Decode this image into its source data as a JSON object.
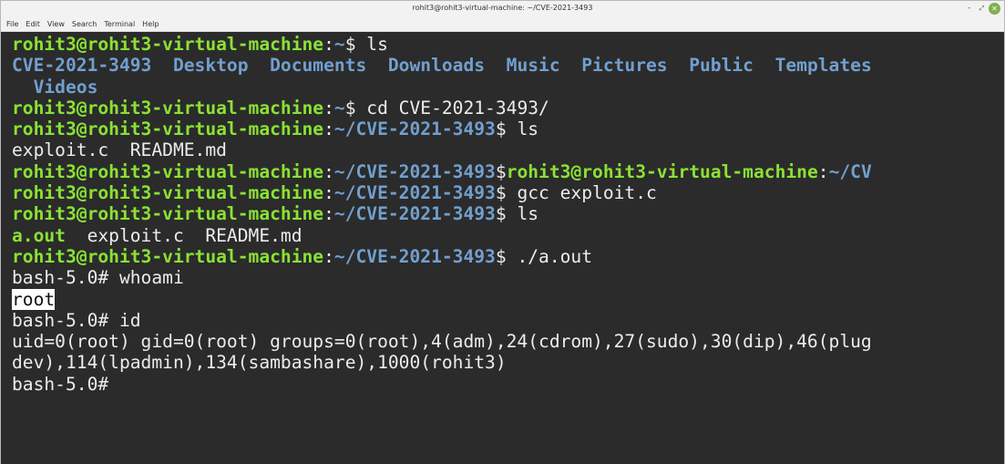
{
  "window": {
    "title": "rohit3@rohit3-virtual-machine: ~/CVE-2021-3493",
    "menu": [
      "File",
      "Edit",
      "View",
      "Search",
      "Terminal",
      "Help"
    ],
    "controls": {
      "minimize": "-",
      "maximize": "⤢",
      "close": "✕"
    }
  },
  "terminal": {
    "colors": {
      "background": "#2b2b2b",
      "prompt": "#8ae234",
      "path": "#729fcf",
      "text": "#ececec"
    },
    "lines": [
      [
        {
          "text": "rohit3@rohit3-virtual-machine",
          "style": "prompt"
        },
        {
          "text": ":",
          "style": "plain"
        },
        {
          "text": "~",
          "style": "path"
        },
        {
          "text": "$ ls",
          "style": "plain"
        }
      ],
      [
        {
          "text": "CVE-2021-3493",
          "style": "dir"
        },
        {
          "text": "  ",
          "style": "plain"
        },
        {
          "text": "Desktop",
          "style": "dir"
        },
        {
          "text": "  ",
          "style": "plain"
        },
        {
          "text": "Documents",
          "style": "dir"
        },
        {
          "text": "  ",
          "style": "plain"
        },
        {
          "text": "Downloads",
          "style": "dir"
        },
        {
          "text": "  ",
          "style": "plain"
        },
        {
          "text": "Music",
          "style": "dir"
        },
        {
          "text": "  ",
          "style": "plain"
        },
        {
          "text": "Pictures",
          "style": "dir"
        },
        {
          "text": "  ",
          "style": "plain"
        },
        {
          "text": "Public",
          "style": "dir"
        },
        {
          "text": "  ",
          "style": "plain"
        },
        {
          "text": "Templates",
          "style": "dir"
        }
      ],
      [
        {
          "text": "  ",
          "style": "plain"
        },
        {
          "text": "Videos",
          "style": "dir"
        }
      ],
      [
        {
          "text": "rohit3@rohit3-virtual-machine",
          "style": "prompt"
        },
        {
          "text": ":",
          "style": "plain"
        },
        {
          "text": "~",
          "style": "path"
        },
        {
          "text": "$ cd CVE-2021-3493/",
          "style": "plain"
        }
      ],
      [
        {
          "text": "rohit3@rohit3-virtual-machine",
          "style": "prompt"
        },
        {
          "text": ":",
          "style": "plain"
        },
        {
          "text": "~/CVE-2021-3493",
          "style": "path"
        },
        {
          "text": "$ ls",
          "style": "plain"
        }
      ],
      [
        {
          "text": "exploit.c  README.md",
          "style": "plain"
        }
      ],
      [
        {
          "text": "rohit3@rohit3-virtual-machine",
          "style": "prompt"
        },
        {
          "text": ":",
          "style": "plain"
        },
        {
          "text": "~/CVE-2021-3493",
          "style": "path"
        },
        {
          "text": "$",
          "style": "plain"
        },
        {
          "text": "rohit3@rohit3-virtual-machine",
          "style": "prompt"
        },
        {
          "text": ":",
          "style": "plain"
        },
        {
          "text": "~/CV",
          "style": "path"
        }
      ],
      [
        {
          "text": "rohit3@rohit3-virtual-machine",
          "style": "prompt"
        },
        {
          "text": ":",
          "style": "plain"
        },
        {
          "text": "~/CVE-2021-3493",
          "style": "path"
        },
        {
          "text": "$ gcc exploit.c",
          "style": "plain"
        }
      ],
      [
        {
          "text": "rohit3@rohit3-virtual-machine",
          "style": "prompt"
        },
        {
          "text": ":",
          "style": "plain"
        },
        {
          "text": "~/CVE-2021-3493",
          "style": "path"
        },
        {
          "text": "$ ls",
          "style": "plain"
        }
      ],
      [
        {
          "text": "a.out",
          "style": "exec"
        },
        {
          "text": "  exploit.c  README.md",
          "style": "plain"
        }
      ],
      [
        {
          "text": "rohit3@rohit3-virtual-machine",
          "style": "prompt"
        },
        {
          "text": ":",
          "style": "plain"
        },
        {
          "text": "~/CVE-2021-3493",
          "style": "path"
        },
        {
          "text": "$ ./a.out",
          "style": "plain"
        }
      ],
      [
        {
          "text": "bash-5.0# whoami",
          "style": "plain"
        }
      ],
      [
        {
          "text": "root",
          "style": "sel"
        }
      ],
      [
        {
          "text": "bash-5.0# id",
          "style": "plain"
        }
      ],
      [
        {
          "text": "uid=0(root) gid=0(root) groups=0(root),4(adm),24(cdrom),27(sudo),30(dip),46(plug",
          "style": "plain"
        }
      ],
      [
        {
          "text": "dev),114(lpadmin),134(sambashare),1000(rohit3)",
          "style": "plain"
        }
      ],
      [
        {
          "text": "bash-5.0# ",
          "style": "plain"
        }
      ]
    ]
  }
}
